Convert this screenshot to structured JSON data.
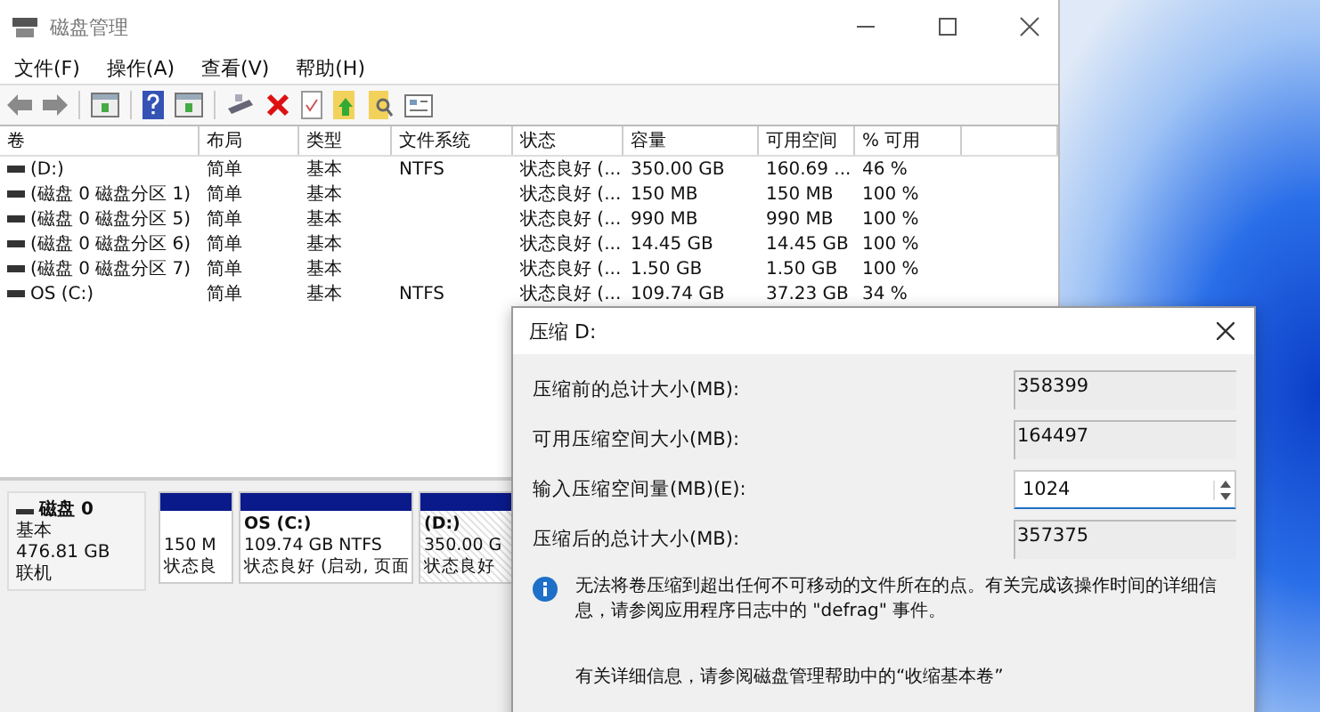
{
  "window": {
    "title": "磁盘管理",
    "menu": [
      "文件(F)",
      "操作(A)",
      "查看(V)",
      "帮助(H)"
    ]
  },
  "table": {
    "columns": [
      "卷",
      "布局",
      "类型",
      "文件系统",
      "状态",
      "容量",
      "可用空间",
      "% 可用"
    ],
    "rows": [
      {
        "cells": [
          "(D:)",
          "简单",
          "基本",
          "NTFS",
          "状态良好 (...",
          "350.00 GB",
          "160.69 ...",
          "46 %"
        ]
      },
      {
        "cells": [
          "(磁盘 0 磁盘分区 1)",
          "简单",
          "基本",
          "",
          "状态良好 (...",
          "150 MB",
          "150 MB",
          "100 %"
        ]
      },
      {
        "cells": [
          "(磁盘 0 磁盘分区 5)",
          "简单",
          "基本",
          "",
          "状态良好 (...",
          "990 MB",
          "990 MB",
          "100 %"
        ]
      },
      {
        "cells": [
          "(磁盘 0 磁盘分区 6)",
          "简单",
          "基本",
          "",
          "状态良好 (...",
          "14.45 GB",
          "14.45 GB",
          "100 %"
        ]
      },
      {
        "cells": [
          "(磁盘 0 磁盘分区 7)",
          "简单",
          "基本",
          "",
          "状态良好 (...",
          "1.50 GB",
          "1.50 GB",
          "100 %"
        ]
      },
      {
        "cells": [
          "OS (C:)",
          "简单",
          "基本",
          "NTFS",
          "状态良好 (...",
          "109.74 GB",
          "37.23 GB",
          "34 %"
        ]
      }
    ]
  },
  "disk_pane": {
    "disk": {
      "name": "磁盘 0",
      "type": "基本",
      "size": "476.81 GB",
      "status": "联机"
    },
    "partitions": [
      {
        "kind": "plain",
        "size": "150 M",
        "status": "状态良"
      },
      {
        "kind": "plain",
        "name": "OS  (C:)",
        "size": "109.74 GB NTFS",
        "status": "状态良好 (启动, 页面"
      },
      {
        "kind": "hatched",
        "name": "(D:)",
        "size": "350.00 G",
        "status": "状态良好"
      }
    ]
  },
  "dialog": {
    "title": "压缩 D:",
    "fields": [
      {
        "kind": "readonly",
        "label": "压缩前的总计大小(MB):",
        "value": "358399"
      },
      {
        "kind": "readonly",
        "label": "可用压缩空间大小(MB):",
        "value": "164497"
      },
      {
        "kind": "spin",
        "label": "输入压缩空间量(MB)(E):",
        "value": "1024"
      },
      {
        "kind": "readonly",
        "label": "压缩后的总计大小(MB):",
        "value": "357375"
      }
    ],
    "info": "无法将卷压缩到超出任何不可移动的文件所在的点。有关完成该操作时间的详细信息，请参阅应用程序日志中的 \"defrag\" 事件。",
    "help_text": "有关详细信息，请参阅磁盘管理帮助中的“收缩基本卷”"
  }
}
